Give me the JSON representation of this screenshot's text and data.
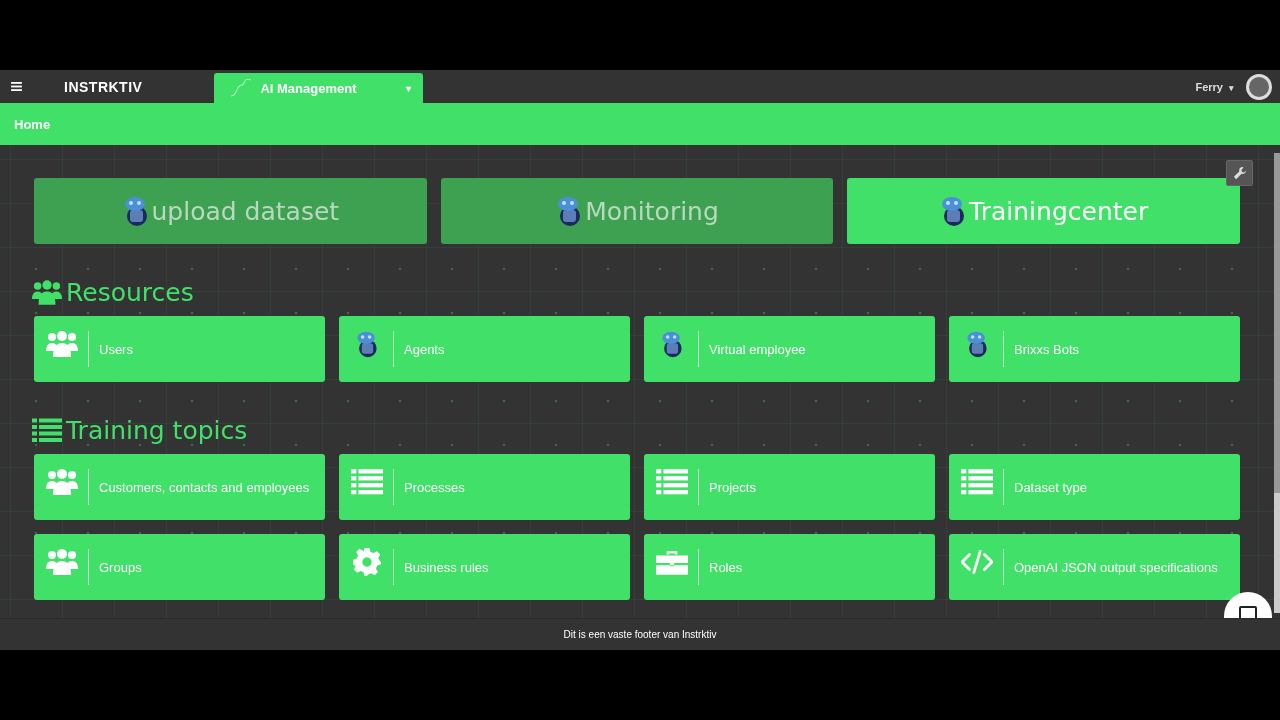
{
  "header": {
    "logo": "INSTRKTIV",
    "app_menu": {
      "label": "AI Management",
      "caret": "▾"
    },
    "user": {
      "name": "Ferry",
      "caret": "▾"
    }
  },
  "breadcrumb": [
    "Home"
  ],
  "top_tiles": [
    {
      "label": "upload dataset",
      "selected": false
    },
    {
      "label": "Monitoring",
      "selected": false
    },
    {
      "label": "Trainingcenter",
      "selected": true
    }
  ],
  "sections": [
    {
      "title": "Resources",
      "kind": "users",
      "tiles": [
        {
          "label": "Users",
          "kind": "users"
        },
        {
          "label": "Agents",
          "kind": "robot"
        },
        {
          "label": "Virtual employee",
          "kind": "robot"
        },
        {
          "label": "Brixxs Bots",
          "kind": "robot"
        }
      ]
    },
    {
      "title": "Training topics",
      "kind": "list",
      "tiles": [
        {
          "label": "Customers, contacts and employees",
          "kind": "users"
        },
        {
          "label": "Processes",
          "kind": "list"
        },
        {
          "label": "Projects",
          "kind": "list"
        },
        {
          "label": "Dataset type",
          "kind": "list"
        },
        {
          "label": "Groups",
          "kind": "users"
        },
        {
          "label": "Business rules",
          "kind": "gear"
        },
        {
          "label": "Roles",
          "kind": "briefcase"
        },
        {
          "label": "OpenAI JSON output specifications",
          "kind": "code"
        }
      ]
    }
  ],
  "footer": "Dit is een vaste footer van Instrktiv"
}
